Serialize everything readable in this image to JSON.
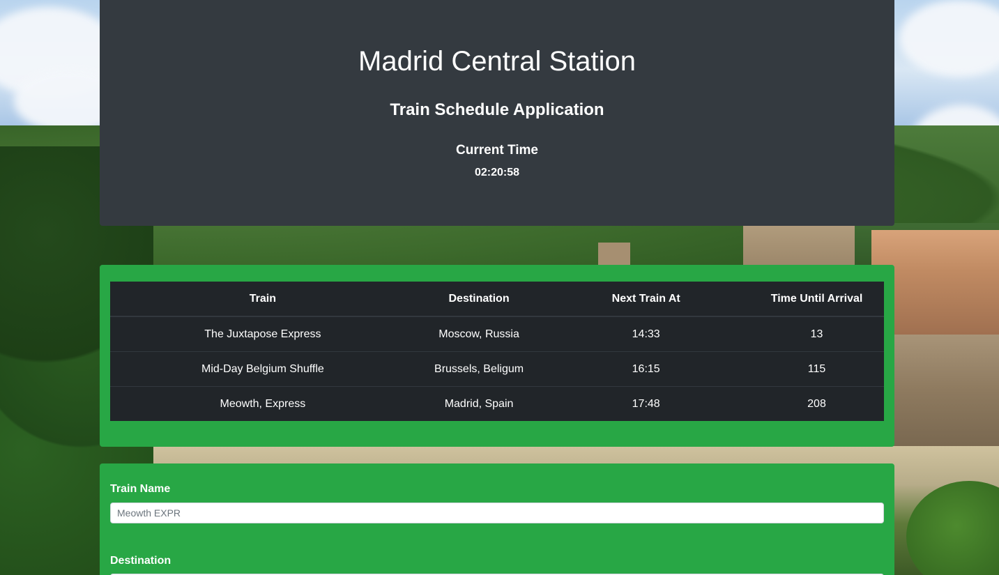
{
  "header": {
    "title": "Madrid Central Station",
    "subtitle": "Train Schedule Application",
    "current_time_label": "Current Time",
    "current_time_value": "02:20:58"
  },
  "schedule": {
    "columns": [
      "Train",
      "Destination",
      "Next Train At",
      "Time Until Arrival"
    ],
    "rows": [
      [
        "The Juxtapose Express",
        "Moscow, Russia",
        "14:33",
        "13"
      ],
      [
        "Mid-Day Belgium Shuffle",
        "Brussels, Beligum",
        "16:15",
        "115"
      ],
      [
        "Meowth, Express",
        "Madrid, Spain",
        "17:48",
        "208"
      ]
    ]
  },
  "form": {
    "train_name_label": "Train Name",
    "train_name_placeholder": "Meowth EXPR",
    "destination_label": "Destination"
  },
  "colors": {
    "header_bg": "#343a40",
    "panel_bg": "#28a745",
    "table_bg": "#212529"
  }
}
